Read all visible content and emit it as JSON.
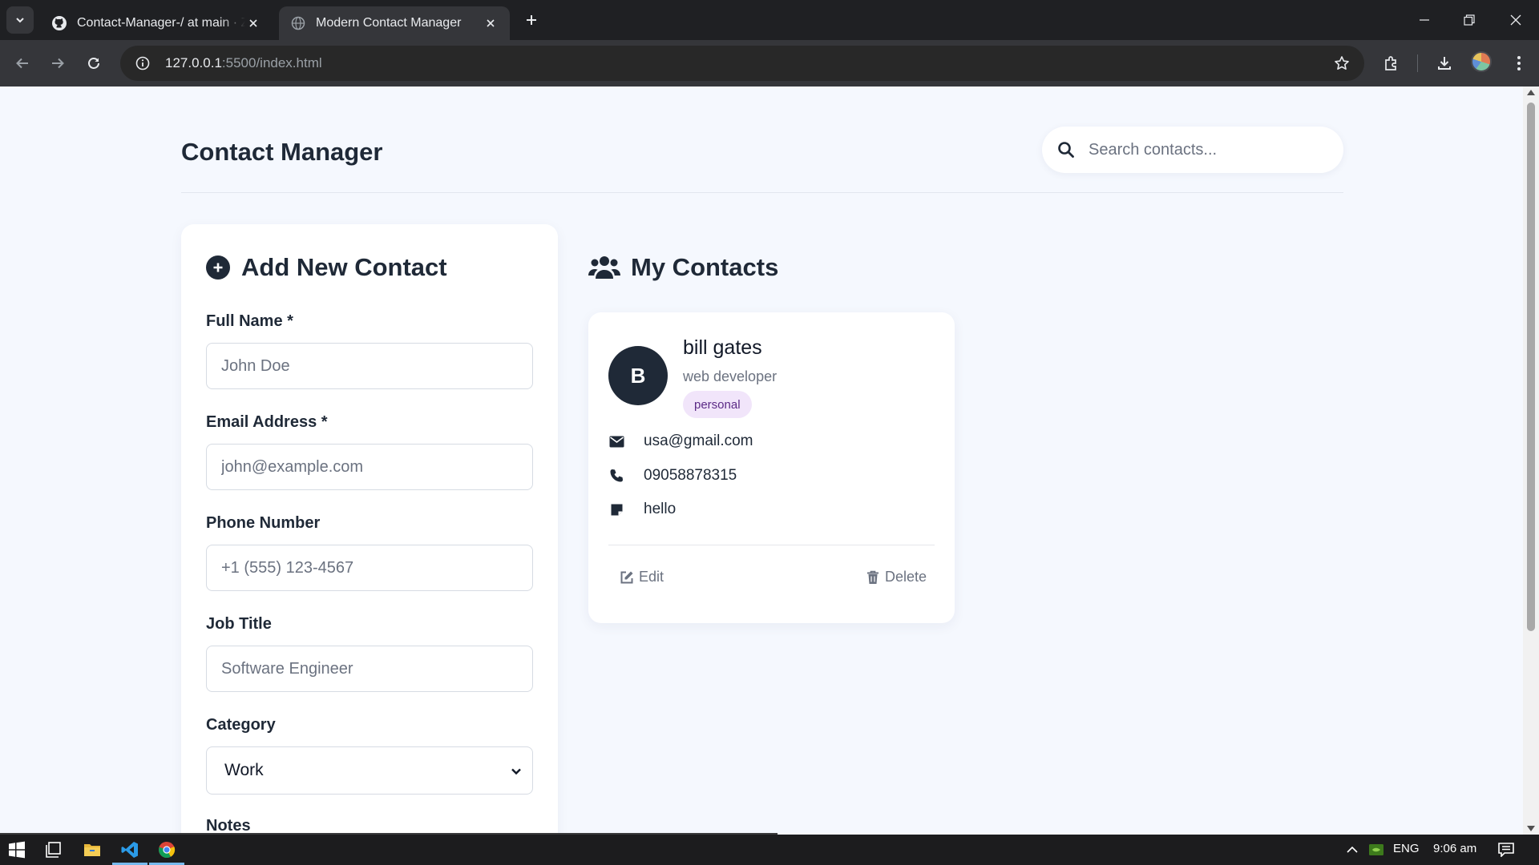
{
  "browser": {
    "tabs": [
      {
        "title": "Contact-Manager-/ at main · Za",
        "favicon": "github-icon",
        "active": false
      },
      {
        "title": "Modern Contact Manager",
        "favicon": "globe-icon",
        "active": true
      }
    ],
    "url_host": "127.0.0.1",
    "url_rest": ":5500/index.html"
  },
  "page": {
    "title": "Contact Manager",
    "search_placeholder": "Search contacts..."
  },
  "form": {
    "heading": "Add New Contact",
    "fields": [
      {
        "label": "Full Name *",
        "placeholder": "John Doe"
      },
      {
        "label": "Email Address *",
        "placeholder": "john@example.com"
      },
      {
        "label": "Phone Number",
        "placeholder": "+1 (555) 123-4567"
      },
      {
        "label": "Job Title",
        "placeholder": "Software Engineer"
      }
    ],
    "category_label": "Category",
    "category_value": "Work",
    "notes_label": "Notes"
  },
  "contacts": {
    "heading": "My Contacts",
    "items": [
      {
        "initial": "B",
        "name": "bill gates",
        "job": "web developer",
        "category": "personal",
        "email": "usa@gmail.com",
        "phone": "09058878315",
        "note": "hello",
        "edit_label": "Edit",
        "delete_label": "Delete"
      }
    ]
  },
  "taskbar": {
    "language": "ENG",
    "time": "9:06 am"
  },
  "colors": {
    "accent_dark": "#1f2937",
    "badge_bg": "#f1e5fa",
    "badge_text": "#5b2a86",
    "page_bg": "#f5f8fe"
  }
}
